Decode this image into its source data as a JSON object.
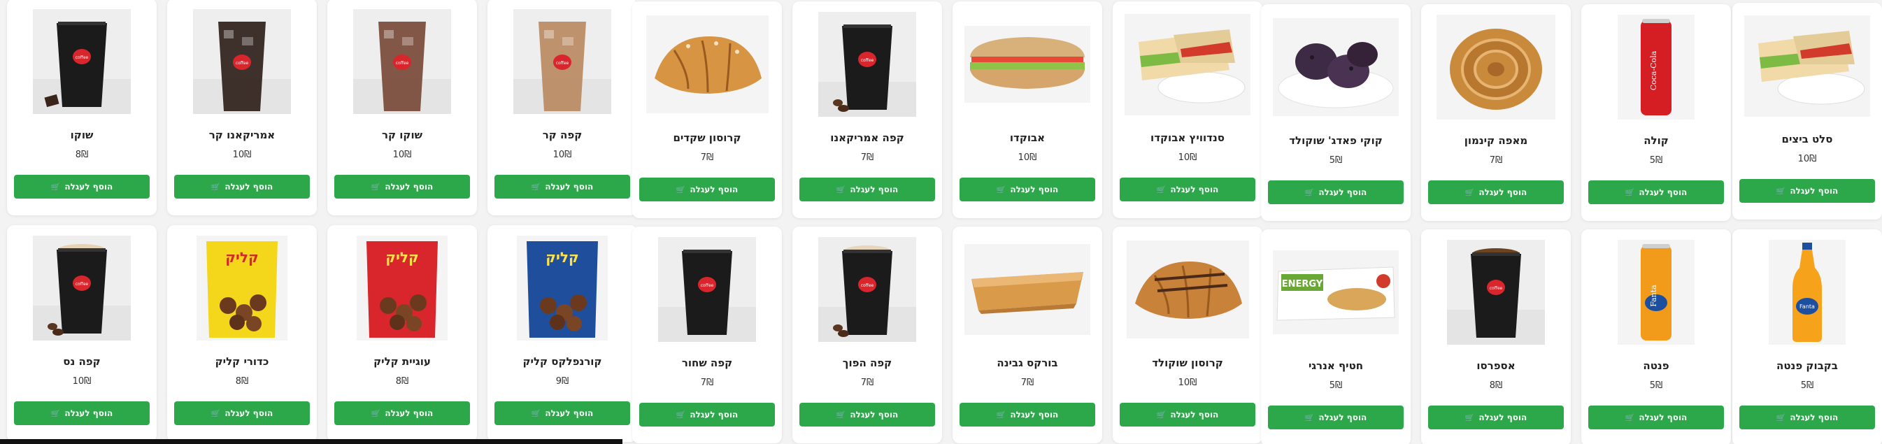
{
  "currency_symbol": "₪",
  "add_to_cart_label": "הוסף לעגלה",
  "cart_icon": "cart-icon",
  "row1": [
    {
      "name": "שוקו",
      "price": "8",
      "image": "chocolate-cup"
    },
    {
      "name": "אמריקאנו קר",
      "price": "10",
      "image": "iced-americano"
    },
    {
      "name": "שוקו קר",
      "price": "10",
      "image": "iced-chocolate"
    },
    {
      "name": "קפה קר",
      "price": "10",
      "image": "iced-coffee"
    },
    {
      "name": "קרוסון שקדים",
      "price": "7",
      "image": "almond-croissant"
    },
    {
      "name": "קפה אמריקאנו",
      "price": "7",
      "image": "americano-cup"
    },
    {
      "name": "אבוקדו",
      "price": "10",
      "image": "avocado-baguette"
    },
    {
      "name": "סנדוויץ אבוקדו",
      "price": "10",
      "image": "avocado-sandwich"
    },
    {
      "name": "קוקי פאדג' שוקולד",
      "price": "5",
      "image": "fudge-cookies"
    },
    {
      "name": "מאפה קינמון",
      "price": "7",
      "image": "cinnamon-roll"
    },
    {
      "name": "קולה",
      "price": "5",
      "image": "cola-can"
    },
    {
      "name": "סלט ביצים",
      "price": "10",
      "image": "egg-sandwich"
    }
  ],
  "row2": [
    {
      "name": "קפה נס",
      "price": "10",
      "image": "nes-cup"
    },
    {
      "name": "כדורי קליק",
      "price": "8",
      "image": "klik-balls"
    },
    {
      "name": "עוגיית קליק",
      "price": "8",
      "image": "klik-cookie"
    },
    {
      "name": "קורנפלקס קליק",
      "price": "9",
      "image": "klik-cornflakes"
    },
    {
      "name": "קפה שחור",
      "price": "7",
      "image": "black-coffee"
    },
    {
      "name": "קפה הפוך",
      "price": "7",
      "image": "latte-cup"
    },
    {
      "name": "בורקס גבינה",
      "price": "7",
      "image": "cheese-burekas"
    },
    {
      "name": "קרוסון שוקולד",
      "price": "10",
      "image": "chocolate-croissant"
    },
    {
      "name": "חטיף אנרגי",
      "price": "5",
      "image": "energy-bar"
    },
    {
      "name": "אספרסו",
      "price": "8",
      "image": "espresso-cup"
    },
    {
      "name": "פנטה",
      "price": "5",
      "image": "fanta-can"
    },
    {
      "name": "בקבוק פנטה",
      "price": "5",
      "image": "fanta-bottle"
    }
  ],
  "colors": {
    "button": "#2ca84a",
    "card": "#ffffff",
    "background": "#f3f3f3"
  }
}
